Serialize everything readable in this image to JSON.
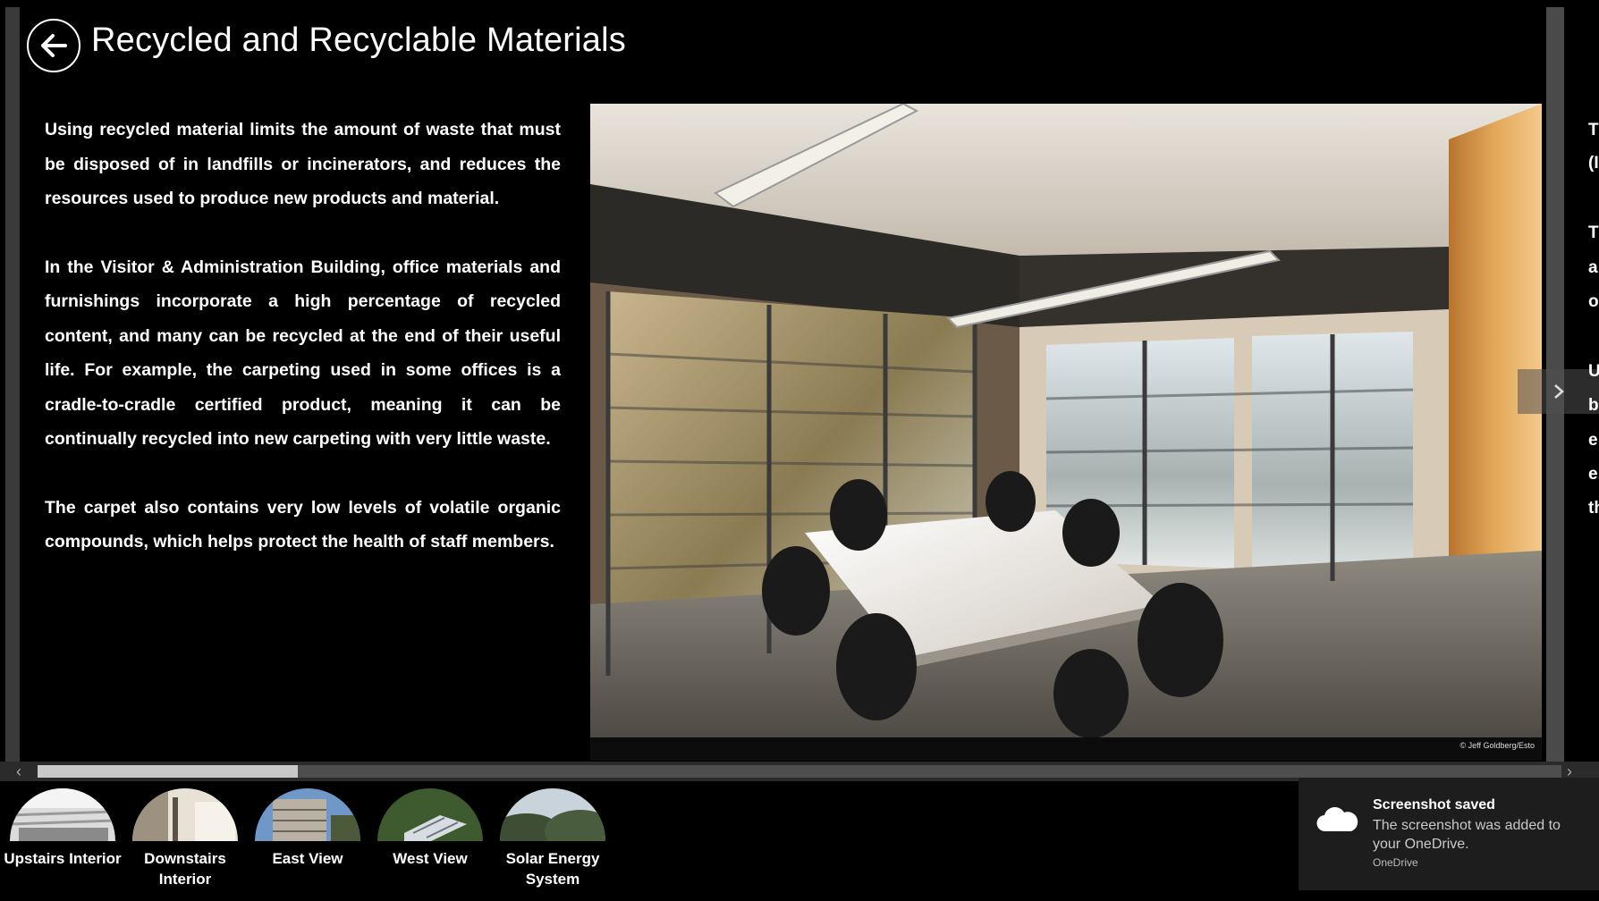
{
  "header": {
    "title": "Recycled and Recyclable Materials",
    "back_icon": "back-arrow-icon"
  },
  "article": {
    "paragraphs": [
      "Using recycled material limits the amount of waste that must be disposed of in landfills or incinerators, and reduces the resources used to produce new products and material.",
      "In the Visitor & Administration Building, office materials and furnishings incorporate a high percentage of recycled content, and many can be recycled at the end of their useful life. For example, the carpeting used in some offices is a cradle-to-cradle certified product, meaning it can be continually recycled into new carpeting with very little waste.",
      "The carpet also contains very low levels of volatile organic compounds, which helps protect the health of staff members."
    ]
  },
  "photo": {
    "credit": "© Jeff Goldberg/Esto"
  },
  "next_page_preview": {
    "lines": [
      "T",
      "(I",
      "T",
      "a",
      "o",
      "U",
      "b",
      "e",
      "e",
      "th"
    ]
  },
  "thumbnails": [
    {
      "label": "Upstairs Interior"
    },
    {
      "label": "Downstairs Interior"
    },
    {
      "label": "East View"
    },
    {
      "label": "West View"
    },
    {
      "label": "Solar Energy System"
    }
  ],
  "toast": {
    "title": "Screenshot saved",
    "message": "The screenshot was added to your OneDrive.",
    "source": "OneDrive",
    "icon": "cloud-icon"
  },
  "colors": {
    "background": "#000000",
    "text": "#ffffff",
    "scroll_thumb": "#c8c8c8",
    "toast_bg": "#1d1d1d"
  }
}
